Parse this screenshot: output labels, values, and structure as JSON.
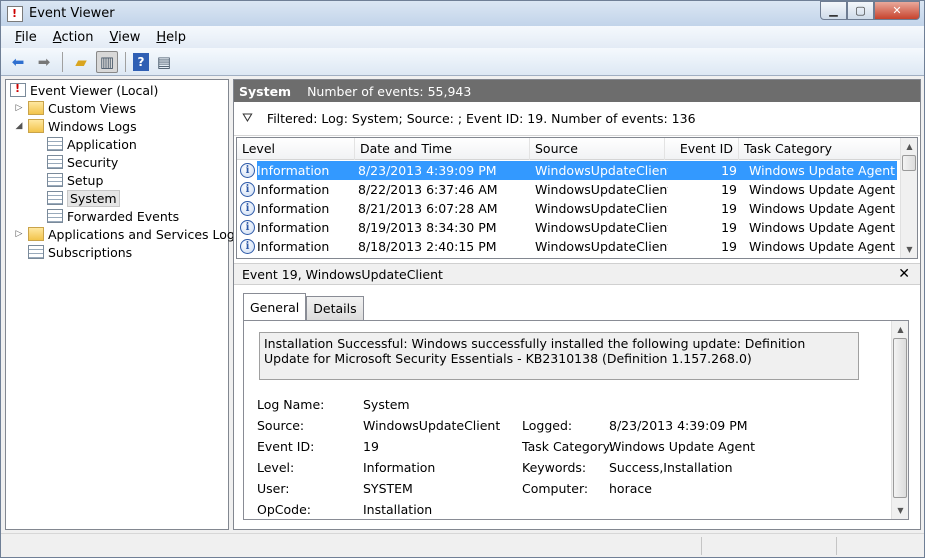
{
  "window": {
    "title": "Event Viewer"
  },
  "menu": [
    {
      "label": "File",
      "accel": "F",
      "rest": "ile"
    },
    {
      "label": "Action",
      "accel": "A",
      "rest": "ction"
    },
    {
      "label": "View",
      "accel": "V",
      "rest": "iew"
    },
    {
      "label": "Help",
      "accel": "H",
      "rest": "elp"
    }
  ],
  "tree": {
    "root": "Event Viewer (Local)",
    "custom_views": "Custom Views",
    "windows_logs": "Windows Logs",
    "application": "Application",
    "security": "Security",
    "setup": "Setup",
    "system": "System",
    "forwarded": "Forwarded Events",
    "apps_services": "Applications and Services Logs",
    "subscriptions": "Subscriptions"
  },
  "pane": {
    "name": "System",
    "count": "Number of events: 55,943",
    "filter": "Filtered: Log: System; Source: ; Event ID: 19. Number of events: 136"
  },
  "table": {
    "headers": {
      "level": "Level",
      "date": "Date and Time",
      "source": "Source",
      "event_id": "Event ID",
      "task": "Task Category"
    },
    "rows": [
      {
        "level": "Information",
        "date": "8/23/2013 4:39:09 PM",
        "source": "WindowsUpdateClient",
        "id": "19",
        "task": "Windows Update Agent"
      },
      {
        "level": "Information",
        "date": "8/22/2013 6:37:46 AM",
        "source": "WindowsUpdateClient",
        "id": "19",
        "task": "Windows Update Agent"
      },
      {
        "level": "Information",
        "date": "8/21/2013 6:07:28 AM",
        "source": "WindowsUpdateClient",
        "id": "19",
        "task": "Windows Update Agent"
      },
      {
        "level": "Information",
        "date": "8/19/2013 8:34:30 PM",
        "source": "WindowsUpdateClient",
        "id": "19",
        "task": "Windows Update Agent"
      },
      {
        "level": "Information",
        "date": "8/18/2013 2:40:15 PM",
        "source": "WindowsUpdateClient",
        "id": "19",
        "task": "Windows Update Agent"
      }
    ]
  },
  "detail": {
    "title": "Event 19, WindowsUpdateClient",
    "tab_general": "General",
    "tab_details": "Details",
    "description": "Installation Successful: Windows successfully installed the following update: Definition Update for Microsoft Security Essentials - KB2310138 (Definition 1.157.268.0)",
    "labels": {
      "log_name": "Log Name:",
      "source": "Source:",
      "event_id": "Event ID:",
      "level": "Level:",
      "user": "User:",
      "opcode": "OpCode:",
      "logged": "Logged:",
      "task_category": "Task Category:",
      "keywords": "Keywords:",
      "computer": "Computer:"
    },
    "values": {
      "log_name": "System",
      "source": "WindowsUpdateClient",
      "event_id": "19",
      "level": "Information",
      "user": "SYSTEM",
      "opcode": "Installation",
      "logged": "8/23/2013 4:39:09 PM",
      "task_category": "Windows Update Agent",
      "keywords": "Success,Installation",
      "computer": "horace"
    }
  },
  "colors": {
    "selection": "#3399ff",
    "pane_header": "#6d6d6d",
    "info_icon": "#2e5aa8"
  }
}
